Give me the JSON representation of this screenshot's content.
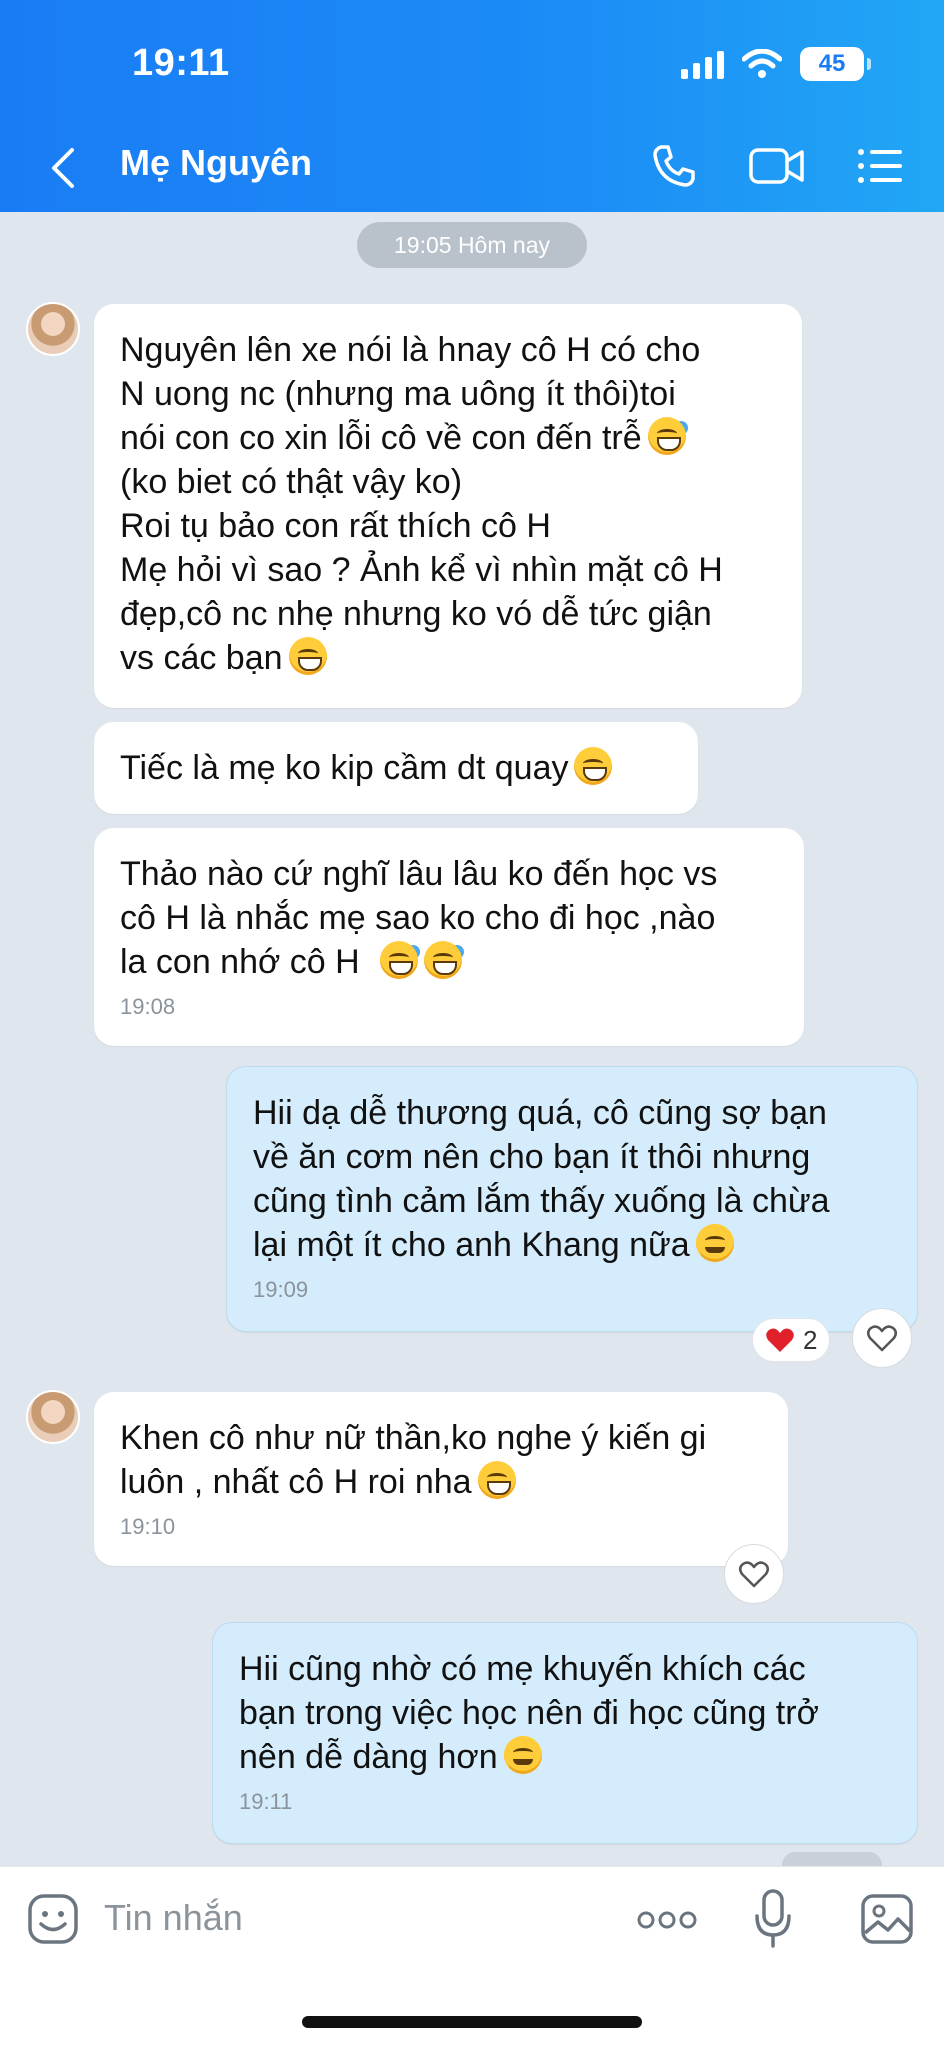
{
  "status_bar": {
    "time": "19:11",
    "battery": "45"
  },
  "header": {
    "title": "Mẹ Nguyên"
  },
  "chat": {
    "date_separator": "19:05 Hôm nay",
    "messages": [
      {
        "sender": "in",
        "lines": [
          "Nguyên lên xe nói là hnay cô H có cho",
          "N uong nc (nhưng ma uông ít thôi)toi",
          "nói con co xin lỗi cô về con đến trễ",
          "(ko biet có thật vậy ko)",
          "Roi tụ bảo con rất thích cô H",
          "Mẹ hỏi vì sao ? Ảnh kể vì nhìn mặt cô H",
          "đẹp,cô nc nhẹ nhưng ko vó dễ tức giận",
          "vs các bạn"
        ]
      },
      {
        "sender": "in",
        "lines": [
          "Tiếc là mẹ ko kip cầm dt quay"
        ]
      },
      {
        "sender": "in",
        "lines": [
          "Thảo nào cứ nghĩ lâu lâu ko đến học vs",
          "cô H là nhắc mẹ sao ko cho đi học ,nào",
          "la con nhớ cô H"
        ],
        "time": "19:08"
      },
      {
        "sender": "out",
        "lines": [
          "Hii dạ dễ thương quá, cô cũng sợ bạn",
          "về ăn cơm nên cho bạn ít thôi nhưng",
          "cũng tình cảm lắm thấy xuống là chừa",
          "lại một ít cho anh Khang nữa"
        ],
        "time": "19:09",
        "reaction_count": "2"
      },
      {
        "sender": "in",
        "lines": [
          "Khen cô như nữ thần,ko nghe ý kiến gi",
          "luôn , nhất cô H roi nha"
        ],
        "time": "19:10"
      },
      {
        "sender": "out",
        "lines": [
          "Hii cũng nhờ có mẹ khuyến khích các",
          "bạn trong việc học nên đi học cũng trở",
          "nên dễ dàng hơn"
        ],
        "time": "19:11"
      }
    ]
  },
  "input": {
    "placeholder": "Tin nhắn"
  },
  "icons": {
    "back": "chevron-left-icon",
    "call": "phone-icon",
    "video": "video-icon",
    "menu": "list-icon",
    "sticker": "emoji-face-icon",
    "more": "more-dots-icon",
    "mic": "microphone-icon",
    "image": "image-icon",
    "heart": "heart-icon"
  },
  "colors": {
    "header": "#1a7cf5",
    "background": "#dfe6ee",
    "incoming_bubble": "#ffffff",
    "outgoing_bubble": "#d4ecfb",
    "reaction_heart": "#e0202b"
  }
}
